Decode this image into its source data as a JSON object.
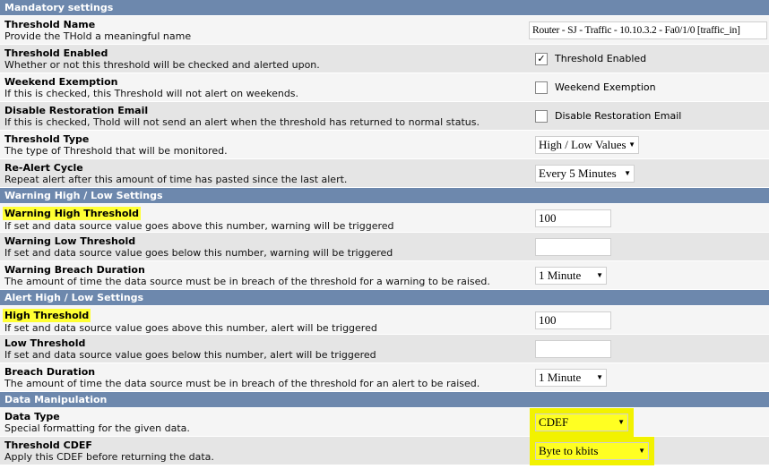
{
  "sections": [
    {
      "title": "Mandatory settings",
      "rows": [
        {
          "label": "Threshold Name",
          "desc": "Provide the THold a meaningful name",
          "type": "text",
          "value": "Router - SJ - Traffic - 10.10.3.2 - Fa0/1/0 [traffic_in]"
        },
        {
          "label": "Threshold Enabled",
          "desc": "Whether or not this threshold will be checked and alerted upon.",
          "type": "checkbox",
          "checked": true,
          "cblabel": "Threshold Enabled",
          "mark": "✓"
        },
        {
          "label": "Weekend Exemption",
          "desc": "If this is checked, this Threshold will not alert on weekends.",
          "type": "checkbox",
          "checked": false,
          "cblabel": "Weekend Exemption"
        },
        {
          "label": "Disable Restoration Email",
          "desc": "If this is checked, Thold will not send an alert when the threshold has returned to normal status.",
          "type": "checkbox",
          "checked": false,
          "cblabel": "Disable Restoration Email"
        },
        {
          "label": "Threshold Type",
          "desc": "The type of Threshold that will be monitored.",
          "type": "select",
          "value": "High / Low Values"
        },
        {
          "label": "Re-Alert Cycle",
          "desc": "Repeat alert after this amount of time has pasted since the last alert.",
          "type": "select",
          "value": "Every 5 Minutes"
        }
      ]
    },
    {
      "title": "Warning High / Low Settings",
      "rows": [
        {
          "label": "Warning High Threshold",
          "desc": "If set and data source value goes above this number, warning will be triggered",
          "type": "text",
          "value": "100",
          "highlight": true
        },
        {
          "label": "Warning Low Threshold",
          "desc": "If set and data source value goes below this number, warning will be triggered",
          "type": "text",
          "value": ""
        },
        {
          "label": "Warning Breach Duration",
          "desc": "The amount of time the data source must be in breach of the threshold for a warning to be raised.",
          "type": "select",
          "value": "1 Minute"
        }
      ]
    },
    {
      "title": "Alert High / Low Settings",
      "rows": [
        {
          "label": "High Threshold",
          "desc": "If set and data source value goes above this number, alert will be triggered",
          "type": "text",
          "value": "100",
          "highlight": true
        },
        {
          "label": "Low Threshold",
          "desc": "If set and data source value goes below this number, alert will be triggered",
          "type": "text",
          "value": ""
        },
        {
          "label": "Breach Duration",
          "desc": "The amount of time the data source must be in breach of the threshold for an alert to be raised.",
          "type": "select",
          "value": "1 Minute"
        }
      ]
    },
    {
      "title": "Data Manipulation",
      "rows": [
        {
          "label": "Data Type",
          "desc": "Special formatting for the given data.",
          "type": "select",
          "value": "CDEF",
          "highlight": true
        },
        {
          "label": "Threshold CDEF",
          "desc": "Apply this CDEF before returning the data.",
          "type": "select",
          "value": "Byte to kbits",
          "highlight": true
        }
      ]
    }
  ],
  "arrow": "▼",
  "colors": {
    "header": "#6d88ad",
    "row_light": "#f5f5f5",
    "row_dark": "#e5e5e5",
    "highlight": "#ffff33"
  }
}
